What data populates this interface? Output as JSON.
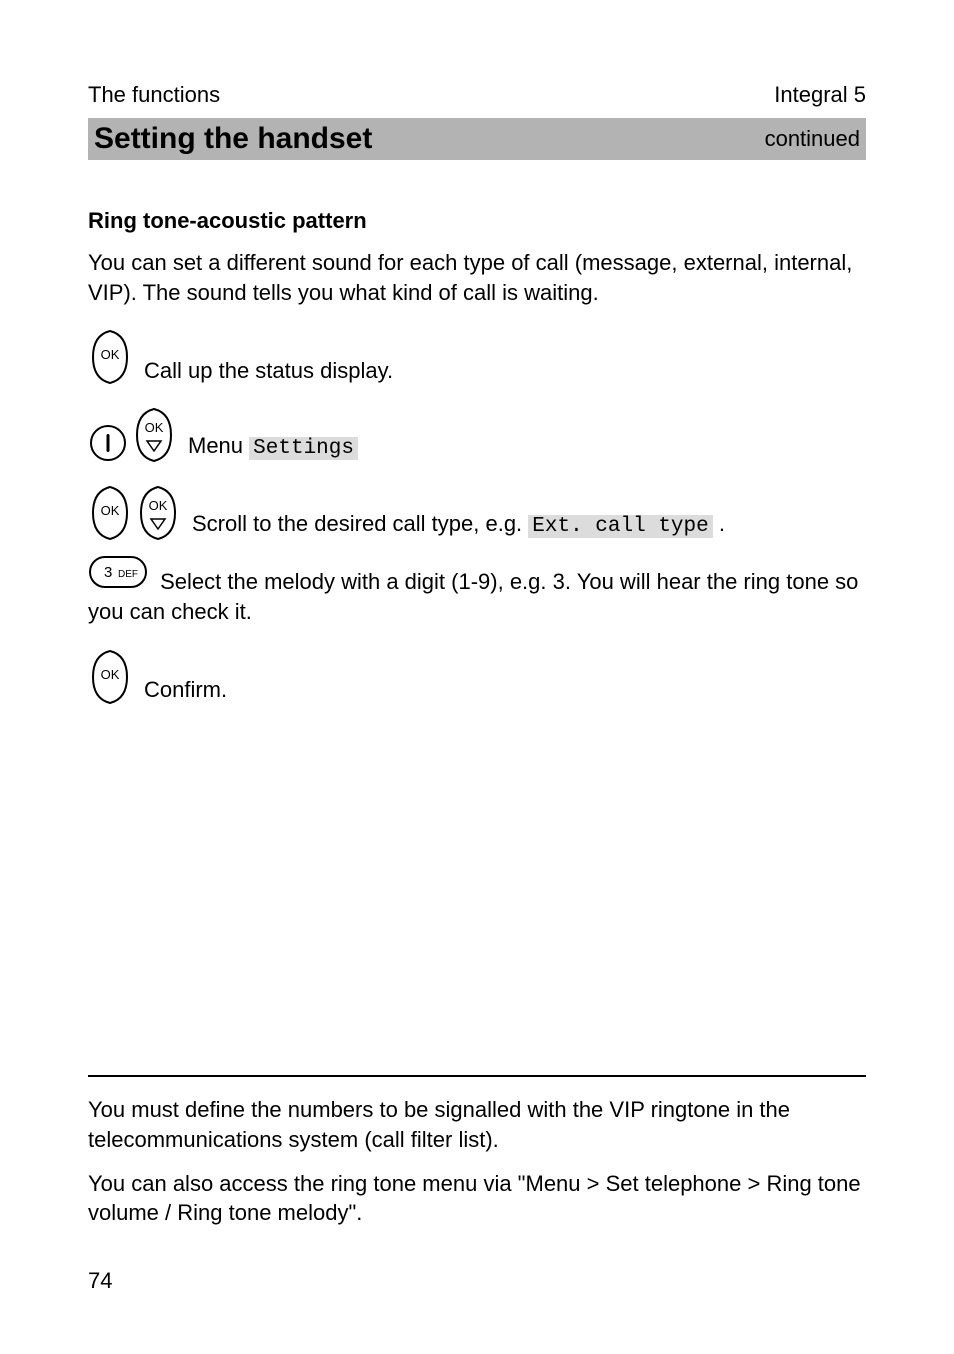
{
  "header": {
    "left": "The functions",
    "right": "Integral 5"
  },
  "title_bar": {
    "main": "Setting the handset",
    "continued": "continued"
  },
  "section_heading": "Ring tone-acoustic pattern",
  "intro_para": "You can set a different sound for each type of call (message, external, internal, VIP). The sound tells you what kind of call is waiting.",
  "steps": {
    "s1_text": " Call up the status display.",
    "s2_prefix": " Menu ",
    "s2_chip": "Settings",
    "s3_prefix": " Scroll to the desired call type, e.g. ",
    "s3_chip": "Ext. call type",
    "s3_suffix": " .",
    "s4_prefix_after_icon": " Select the melody with a digit (1-9), e.g. 3. You will hear the ring tone so you can check it.",
    "s5_text": " Confirm."
  },
  "digit_key": {
    "label": "3 DEF"
  },
  "icons": {
    "ok": "OK",
    "down": "▽",
    "circle_i": "I"
  },
  "footer": {
    "note1": "You must define the numbers to be signalled with the VIP ringtone in the telecommunications system (call filter list).",
    "note2": "You can also access the ring tone menu via \"Menu > Set telephone > Ring tone volume / Ring tone melody\"."
  },
  "page_number": "74"
}
